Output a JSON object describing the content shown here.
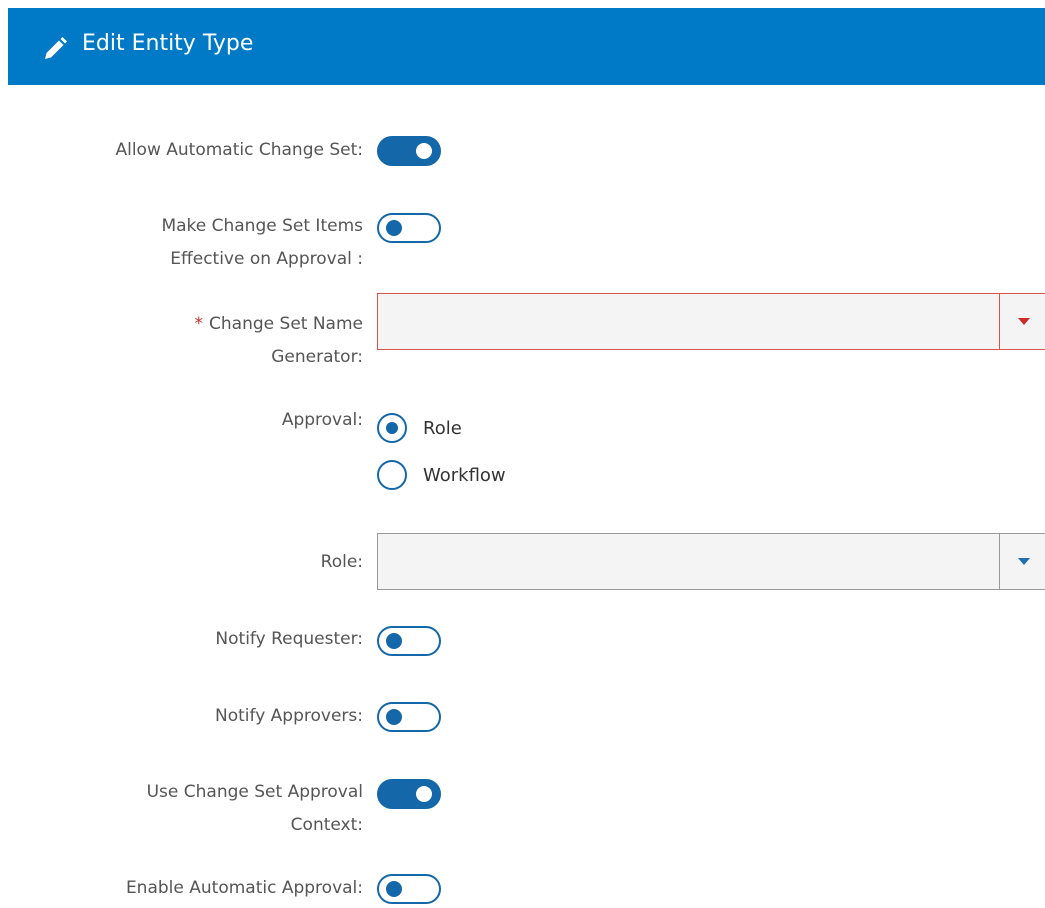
{
  "header": {
    "title": "Edit Entity Type",
    "icon": "pencil-icon",
    "background": "#007ac6"
  },
  "form": {
    "allow_automatic_change_set": {
      "label": "Allow Automatic Change Set:",
      "value": true
    },
    "make_change_set_items_effective": {
      "label_line1": "Make Change Set Items",
      "label_line2": "Effective on Approval :",
      "value": false
    },
    "change_set_name_generator": {
      "required_marker": "*",
      "label_line1": "Change Set Name",
      "label_line2": "Generator:",
      "value": "",
      "state": "error"
    },
    "approval": {
      "label": "Approval:",
      "options": [
        {
          "label": "Role",
          "checked": true
        },
        {
          "label": "Workflow",
          "checked": false
        }
      ]
    },
    "role": {
      "label": "Role:",
      "value": ""
    },
    "notify_requester": {
      "label": "Notify Requester:",
      "value": false
    },
    "notify_approvers": {
      "label": "Notify Approvers:",
      "value": false
    },
    "use_change_set_approval_context": {
      "label_line1": "Use Change Set Approval",
      "label_line2": "Context:",
      "value": true
    },
    "enable_automatic_approval": {
      "label": "Enable Automatic Approval:",
      "value": false
    }
  },
  "colors": {
    "toggle_accent": "#1467a8",
    "error": "#d9534f"
  }
}
